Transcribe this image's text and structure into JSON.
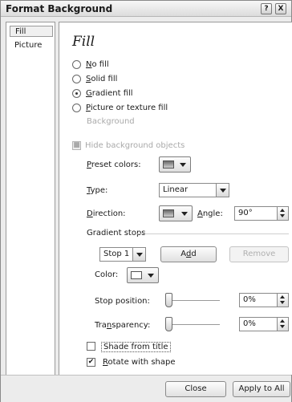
{
  "window": {
    "title": "Format Background",
    "help_glyph": "?",
    "close_glyph": "X"
  },
  "nav": {
    "items": [
      {
        "label": "Fill",
        "active": true
      },
      {
        "label": "Picture",
        "active": false
      }
    ]
  },
  "panel": {
    "heading": "Fill",
    "fill_options": [
      {
        "pre": "",
        "u": "N",
        "post": "o fill",
        "checked": false
      },
      {
        "pre": "",
        "u": "S",
        "post": "olid fill",
        "checked": false
      },
      {
        "pre": "",
        "u": "G",
        "post": "radient fill",
        "checked": true
      },
      {
        "pre": "",
        "u": "P",
        "post": "icture or texture fill",
        "checked": false
      }
    ],
    "background_label": "Background",
    "hide_bg_objects": "Hide background objects",
    "preset_colors": {
      "pre": "",
      "u": "P",
      "post": "reset colors:"
    },
    "type": {
      "pre": "",
      "u": "T",
      "post": "ype:",
      "value": "Linear"
    },
    "direction": {
      "pre": "",
      "u": "D",
      "post": "irection:"
    },
    "angle": {
      "pre": "",
      "u": "A",
      "post": "ngle:",
      "value": "90°"
    },
    "gradient_stops_title": "Gradient stops",
    "stop_select": "Stop 1",
    "add_button": {
      "pre": "A",
      "u": "d",
      "post": "d"
    },
    "remove_button": "Remove",
    "color_label": "Color:",
    "stop_position": {
      "label": "Stop position:",
      "value": "0%",
      "fraction": 0
    },
    "transparency": {
      "pre": "Tra",
      "u": "n",
      "post": "sparency:",
      "value": "0%",
      "fraction": 0
    },
    "shade_from_title": {
      "label": "Shade from title",
      "checked": false
    },
    "rotate_with_shape": {
      "pre": "",
      "u": "R",
      "post": "otate with shape",
      "checked": true
    }
  },
  "footer": {
    "close_label": "Close",
    "apply_all_label": "Apply to All"
  },
  "colors": {
    "dialog_bg": "#ececec",
    "panel_bg": "#ffffff"
  }
}
